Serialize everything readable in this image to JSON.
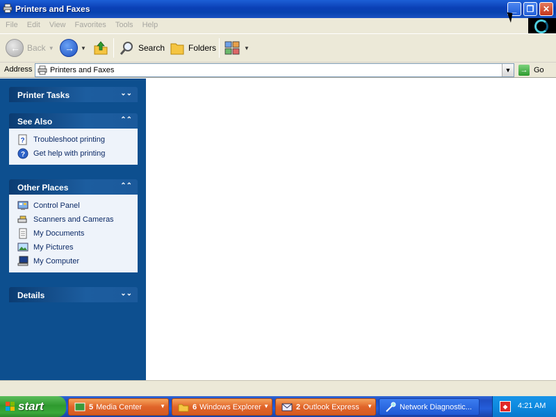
{
  "window": {
    "title": "Printers and Faxes",
    "controls": {
      "minimize": "minimize",
      "maximize": "restore",
      "close": "close"
    }
  },
  "menubar": [
    "File",
    "Edit",
    "View",
    "Favorites",
    "Tools",
    "Help"
  ],
  "toolbar": {
    "back_label": "Back",
    "search_label": "Search",
    "folders_label": "Folders"
  },
  "address": {
    "label": "Address",
    "value": "Printers and Faxes",
    "go_label": "Go"
  },
  "sidebar": {
    "printer_tasks": {
      "title": "Printer Tasks",
      "expanded": false
    },
    "see_also": {
      "title": "See Also",
      "expanded": true,
      "items": [
        {
          "label": "Troubleshoot printing",
          "icon": "help-page-icon"
        },
        {
          "label": "Get help with printing",
          "icon": "help-circle-icon"
        }
      ]
    },
    "other_places": {
      "title": "Other Places",
      "expanded": true,
      "items": [
        {
          "label": "Control Panel",
          "icon": "control-panel-icon"
        },
        {
          "label": "Scanners and Cameras",
          "icon": "scanner-icon"
        },
        {
          "label": "My Documents",
          "icon": "documents-icon"
        },
        {
          "label": "My Pictures",
          "icon": "pictures-icon"
        },
        {
          "label": "My Computer",
          "icon": "computer-icon"
        }
      ]
    },
    "details": {
      "title": "Details",
      "expanded": false
    }
  },
  "taskbar": {
    "start_label": "start",
    "tasks": [
      {
        "count": "5",
        "label": "Media Center",
        "style": "orange"
      },
      {
        "count": "6",
        "label": "Windows Explorer",
        "style": "orange"
      },
      {
        "count": "2",
        "label": "Outlook Express",
        "style": "orange"
      },
      {
        "count": "",
        "label": "Network Diagnostic...",
        "style": "blue"
      }
    ],
    "clock": "4:21 AM"
  },
  "colors": {
    "title_bar": "#0a3fb5",
    "sidebar_bg": "#0d4f8f",
    "panel_body": "#eef3fa",
    "start_button": "#2f9a2f",
    "task_orange": "#e0642a"
  }
}
